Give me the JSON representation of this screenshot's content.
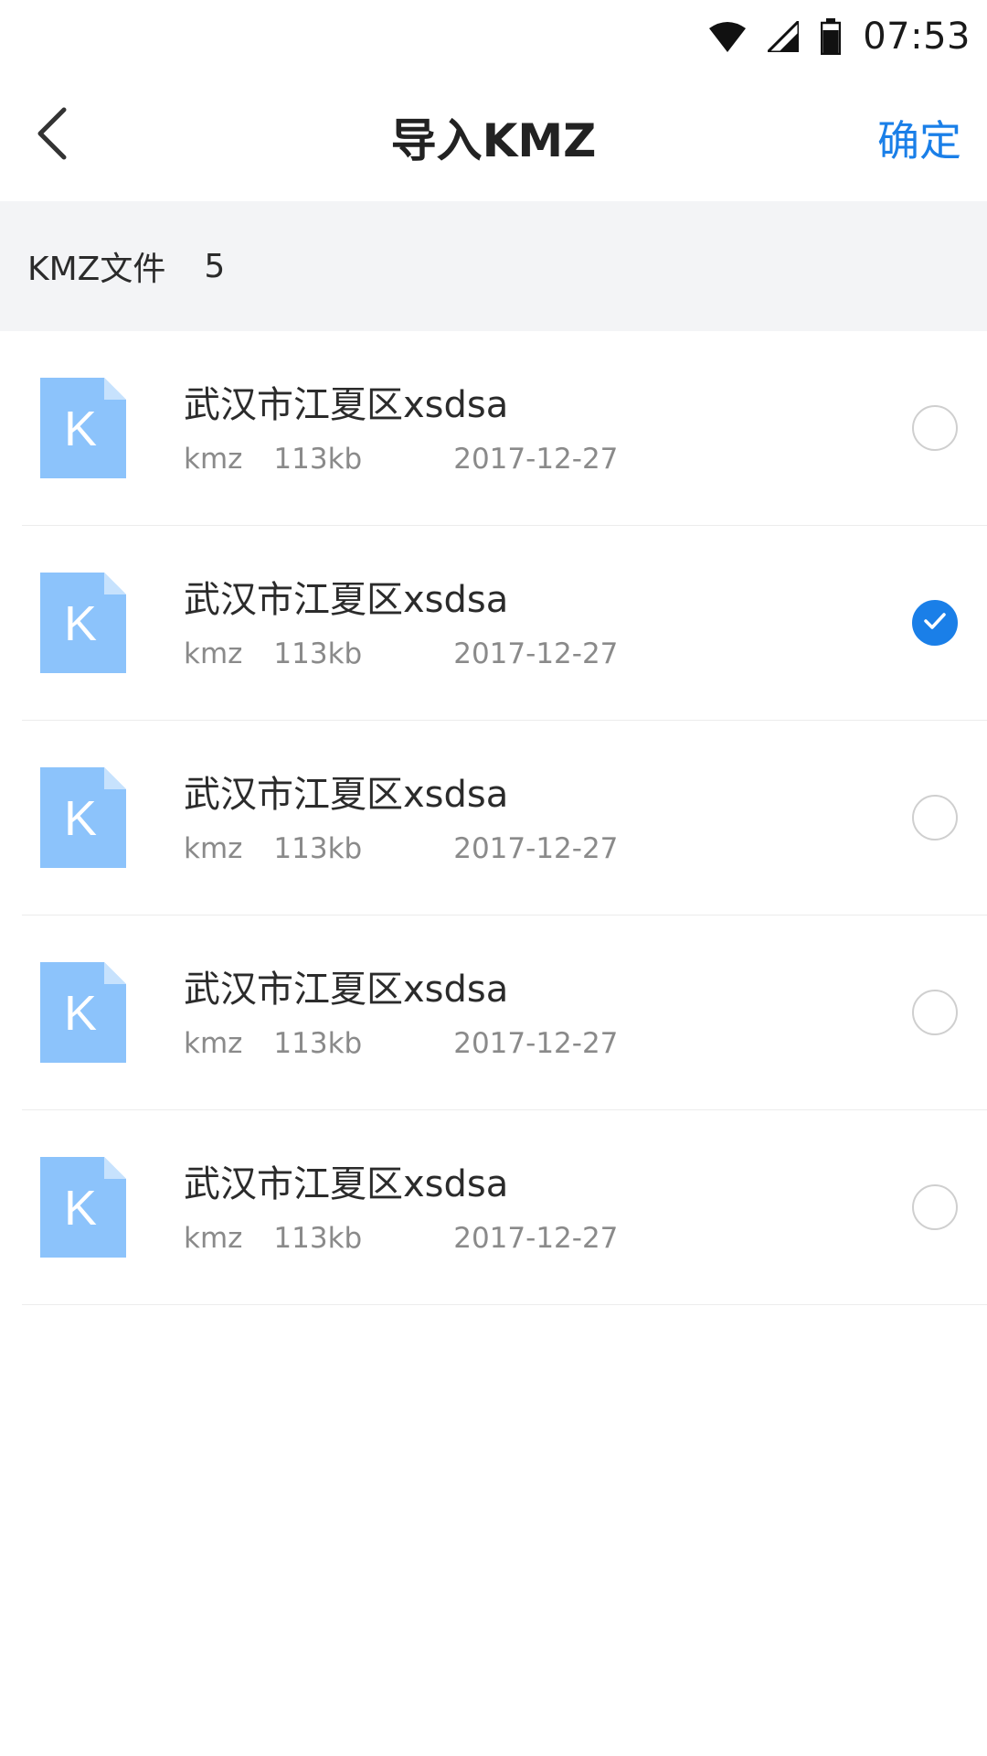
{
  "status_bar": {
    "time": "07:53",
    "icons": [
      "wifi-icon",
      "signal-icon",
      "battery-icon"
    ]
  },
  "header": {
    "back_icon": "chevron-left-icon",
    "title": "导入KMZ",
    "confirm_label": "确定"
  },
  "section": {
    "label": "KMZ文件",
    "count": "5"
  },
  "colors": {
    "accent": "#1a7fe8",
    "file_icon": "#8cc3fb",
    "section_bg": "#f3f4f6"
  },
  "files": [
    {
      "icon_letter": "K",
      "name": "武汉市江夏区xsdsa",
      "type": "kmz",
      "size": "113kb",
      "date": "2017-12-27",
      "selected": false
    },
    {
      "icon_letter": "K",
      "name": "武汉市江夏区xsdsa",
      "type": "kmz",
      "size": "113kb",
      "date": "2017-12-27",
      "selected": true
    },
    {
      "icon_letter": "K",
      "name": "武汉市江夏区xsdsa",
      "type": "kmz",
      "size": "113kb",
      "date": "2017-12-27",
      "selected": false
    },
    {
      "icon_letter": "K",
      "name": "武汉市江夏区xsdsa",
      "type": "kmz",
      "size": "113kb",
      "date": "2017-12-27",
      "selected": false
    },
    {
      "icon_letter": "K",
      "name": "武汉市江夏区xsdsa",
      "type": "kmz",
      "size": "113kb",
      "date": "2017-12-27",
      "selected": false
    }
  ]
}
